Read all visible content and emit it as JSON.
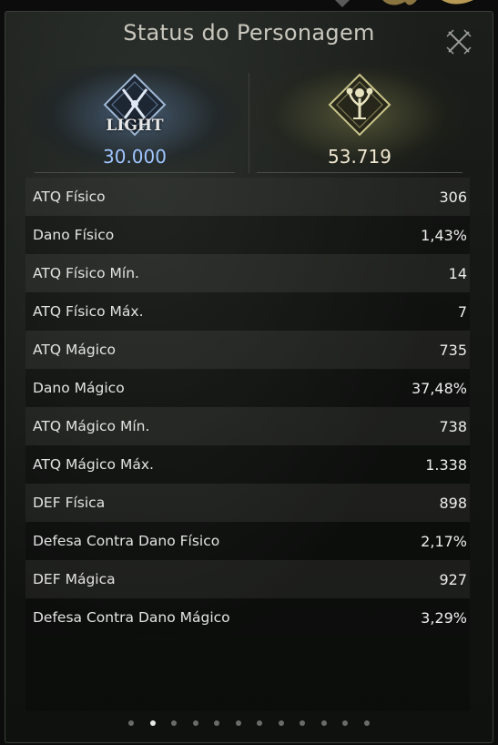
{
  "window": {
    "title": "Status do Personagem"
  },
  "left_stat": {
    "emblem": "crossed-swords-icon",
    "label": "LIGHT",
    "value": "30.000"
  },
  "right_stat": {
    "emblem": "tree-icon",
    "value": "53.719"
  },
  "stats": [
    {
      "label": "ATQ Físico",
      "value": "306"
    },
    {
      "label": "Dano Físico",
      "value": "1,43%"
    },
    {
      "label": "ATQ Físico Mín.",
      "value": "14"
    },
    {
      "label": "ATQ Físico Máx.",
      "value": "7"
    },
    {
      "label": "ATQ Mágico",
      "value": "735"
    },
    {
      "label": "Dano Mágico",
      "value": "37,48%"
    },
    {
      "label": "ATQ Mágico Mín.",
      "value": "738"
    },
    {
      "label": "ATQ Mágico Máx.",
      "value": "1.338"
    },
    {
      "label": "DEF Física",
      "value": "898"
    },
    {
      "label": "Defesa Contra Dano Físico",
      "value": "2,17%"
    },
    {
      "label": "DEF Mágica",
      "value": "927"
    },
    {
      "label": "Defesa Contra Dano Mágico",
      "value": "3,29%"
    }
  ],
  "pager": {
    "pages": 12,
    "active": 2
  },
  "colors": {
    "light_value": "#9ec6ff",
    "accent_gold": "#c9b27a",
    "panel_bg": "#151715"
  }
}
